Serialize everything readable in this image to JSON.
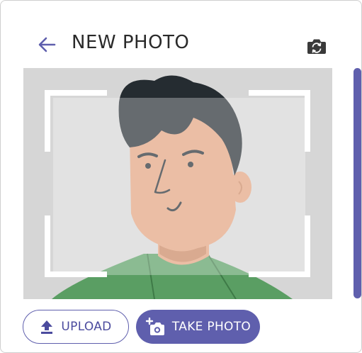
{
  "header": {
    "title": "NEW PHOTO"
  },
  "icons": {
    "back": "arrow-left-icon",
    "switch_camera": "switch-camera-icon",
    "upload": "upload-icon",
    "add_photo": "add-photo-icon"
  },
  "actions": {
    "upload_label": "UPLOAD",
    "take_photo_label": "TAKE PHOTO"
  },
  "colors": {
    "accent": "#5f5fad",
    "skin": "#e2a27f",
    "hair": "#252c31",
    "shirt": "#5a9e63",
    "preview_bg": "#d6d6d6"
  }
}
